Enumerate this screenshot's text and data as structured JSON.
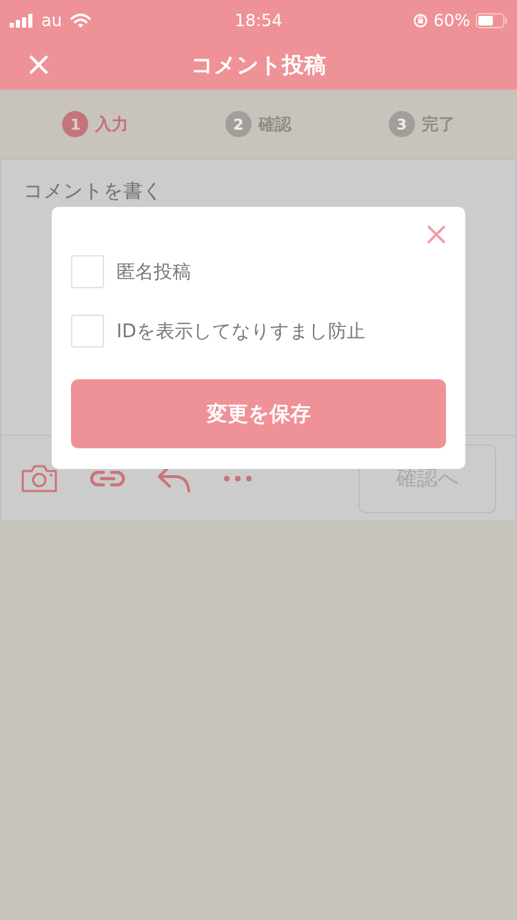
{
  "status_bar": {
    "carrier": "au",
    "time": "18:54",
    "battery": "60%"
  },
  "header": {
    "close": "×",
    "title": "コメント投稿"
  },
  "steps": [
    {
      "number": "1",
      "label": "入力",
      "selected": true
    },
    {
      "number": "2",
      "label": "確認",
      "selected": false
    },
    {
      "number": "3",
      "label": "完了",
      "selected": false
    }
  ],
  "comment": {
    "placeholder": "コメントを書く"
  },
  "toolbar": {
    "confirm_button": "確認へ"
  },
  "dialog": {
    "options": [
      {
        "label": "匿名投稿",
        "checked": false
      },
      {
        "label": "IDを表示してなりすまし防止",
        "checked": false
      }
    ],
    "save_button": "変更を保存"
  }
}
